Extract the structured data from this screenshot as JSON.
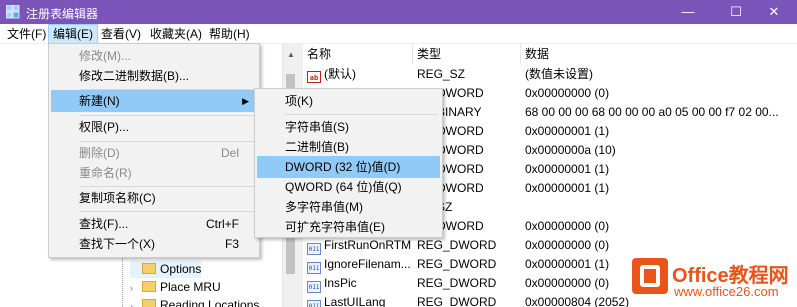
{
  "window": {
    "title": "注册表编辑器",
    "minimize": "—",
    "maximize": "☐",
    "close": "✕",
    "accent_color": "#7a54b8"
  },
  "menubar": [
    "文件(F)",
    "编辑(E)",
    "查看(V)",
    "收藏夹(A)",
    "帮助(H)"
  ],
  "edit_menu": {
    "items": [
      {
        "label": "修改(M)...",
        "disabled": true
      },
      {
        "label": "修改二进制数据(B)...",
        "disabled": false
      },
      {
        "label": "新建(N)",
        "submenu": true,
        "highlighted": true
      },
      {
        "label": "权限(P)...",
        "disabled": false
      },
      {
        "label": "删除(D)",
        "shortcut": "Del",
        "disabled": true
      },
      {
        "label": "重命名(R)",
        "disabled": true
      },
      {
        "label": "复制项名称(C)",
        "disabled": false
      },
      {
        "label": "查找(F)...",
        "shortcut": "Ctrl+F",
        "disabled": false
      },
      {
        "label": "查找下一个(X)",
        "shortcut": "F3",
        "disabled": false
      }
    ]
  },
  "new_submenu": {
    "items": [
      {
        "label": "项(K)"
      },
      {
        "label": "字符串值(S)"
      },
      {
        "label": "二进制值(B)"
      },
      {
        "label": "DWORD (32 位)值(D)",
        "highlighted": true
      },
      {
        "label": "QWORD (64 位)值(Q)"
      },
      {
        "label": "多字符串值(M)"
      },
      {
        "label": "可扩充字符串值(E)"
      }
    ]
  },
  "tree": {
    "items": [
      {
        "label": "Options",
        "selected": true
      },
      {
        "label": "Place MRU",
        "selected": false
      },
      {
        "label": "Reading Locations",
        "selected": false
      }
    ]
  },
  "list": {
    "headers": [
      "名称",
      "类型",
      "数据"
    ],
    "rows": [
      {
        "name": "(默认)",
        "type": "REG_SZ",
        "data": "(数值未设置)",
        "icon": "string-value-icon"
      },
      {
        "name": "",
        "type": "DWORD",
        "data": "0x00000000 (0)",
        "icon": "dword-value-icon"
      },
      {
        "name": "",
        "type": "BINARY",
        "data": "68 00 00 00 68 00 00 00 a0 05 00 00 f7 02 00...",
        "icon": "binary-value-icon"
      },
      {
        "name": "",
        "type": "DWORD",
        "data": "0x00000001 (1)",
        "icon": "dword-value-icon"
      },
      {
        "name": "",
        "type": "DWORD",
        "data": "0x0000000a (10)",
        "icon": "dword-value-icon"
      },
      {
        "name": "",
        "type": "DWORD",
        "data": "0x00000001 (1)",
        "icon": "dword-value-icon"
      },
      {
        "name": "",
        "type": "DWORD",
        "data": "0x00000001 (1)",
        "icon": "dword-value-icon"
      },
      {
        "name": "",
        "type": "SZ",
        "data": "",
        "icon": "string-value-icon"
      },
      {
        "name": "",
        "type": "DWORD",
        "data": "0x00000000 (0)",
        "icon": "dword-value-icon"
      },
      {
        "name": "FirstRunOnRTM",
        "type": "REG_DWORD",
        "data": "0x00000000 (0)",
        "icon": "dword-value-icon"
      },
      {
        "name": "IgnoreFilenam...",
        "type": "REG_DWORD",
        "data": "0x00000001 (1)",
        "icon": "dword-value-icon"
      },
      {
        "name": "InsPic",
        "type": "REG_DWORD",
        "data": "0x00000000 (0)",
        "icon": "dword-value-icon"
      },
      {
        "name": "LastUILang",
        "type": "REG_DWORD",
        "data": "0x00000804 (2052)",
        "icon": "dword-value-icon"
      }
    ]
  },
  "watermark": {
    "brand": "Office教程网",
    "url": "www.office26.com",
    "color": "#e8541a"
  }
}
